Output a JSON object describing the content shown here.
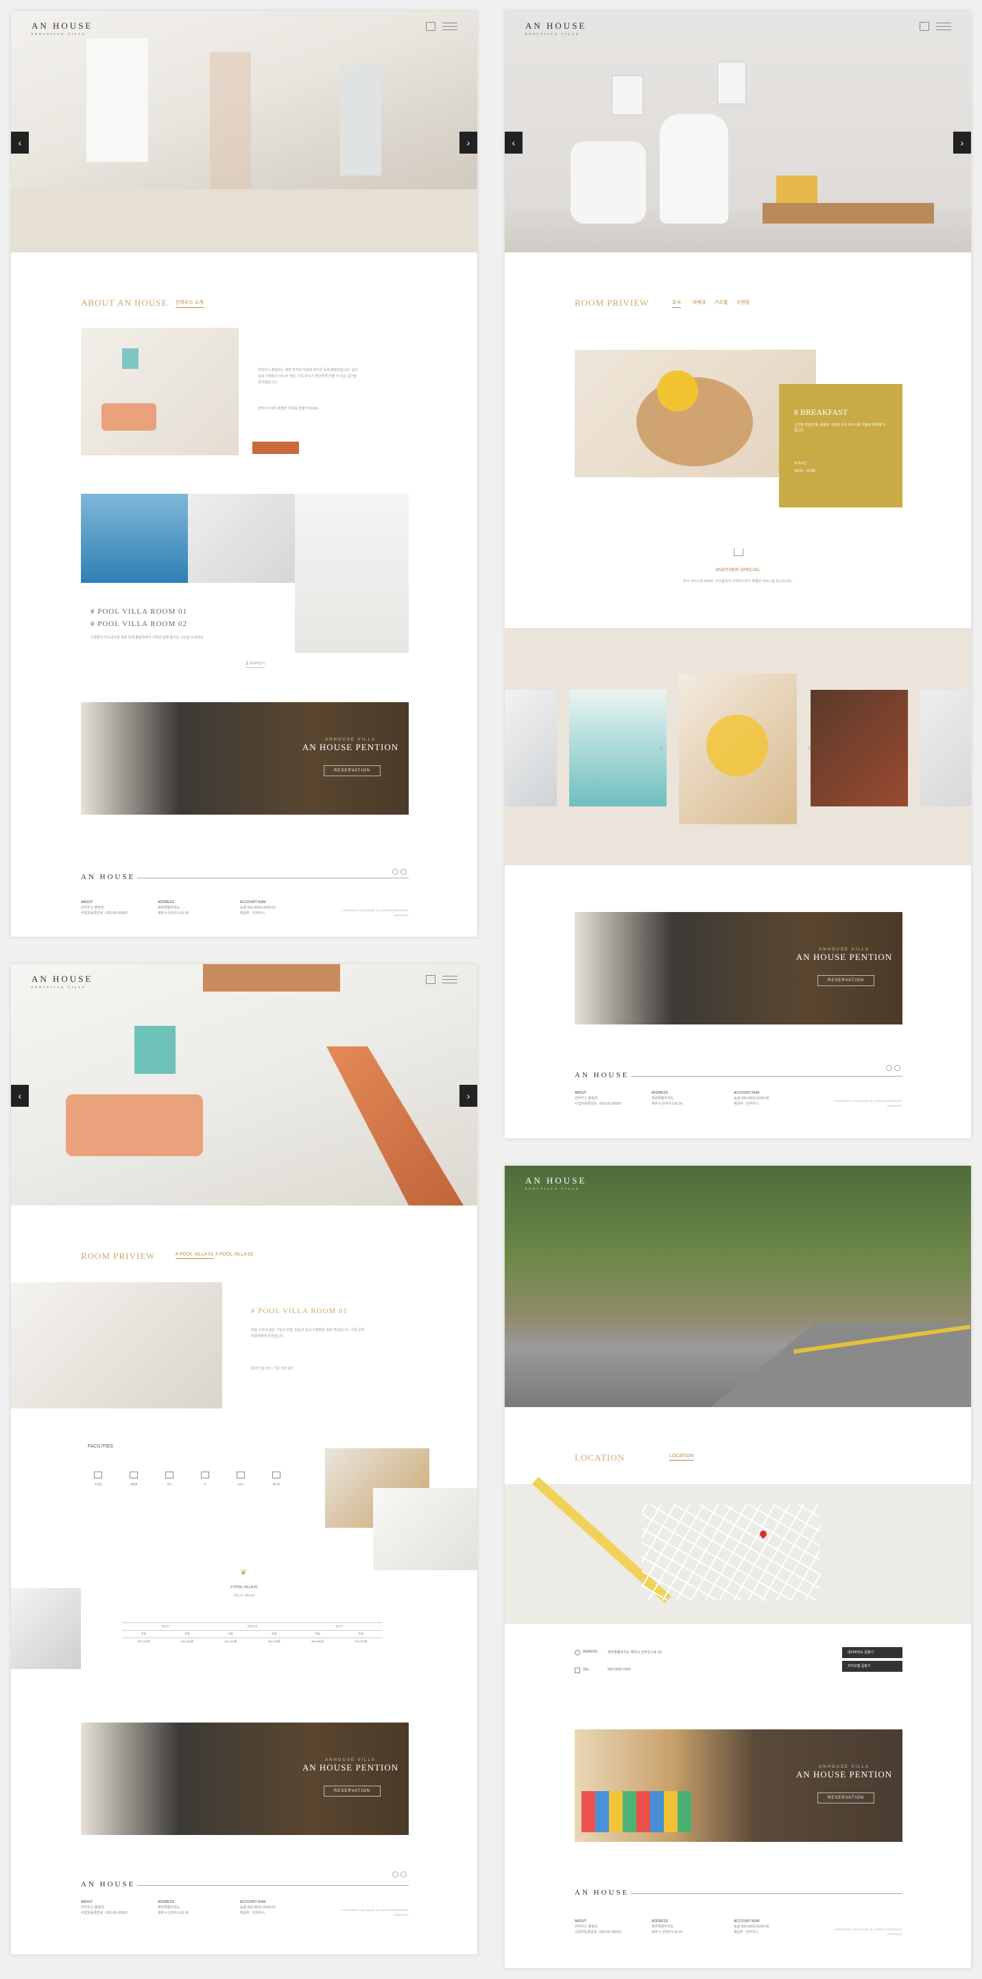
{
  "brand": {
    "name": "AN HOUSE",
    "sub": "POOLVILLA VILLA"
  },
  "panel1": {
    "about_title": "ABOUT AN HOUSE",
    "about_tab": "안하우스 소개",
    "about_para": "안하우스 풀빌라는 제주 한적한 마을에 자리한 독채 풀빌라입니다. 넓은 실내 수영장과 아늑한 객실, 가족 모두가 편안하게 머물 수 있는 공간을 준비했습니다.",
    "about_para2": "안하우스에서 특별한 하루를 만들어 보세요.",
    "room1": "# POOL VILLA ROOM 01",
    "room2": "# POOL VILLA ROOM 02",
    "rooms_para": "수영장과 키즈공간을 갖춘 독채 풀빌라에서 가족과 함께 즐거운 시간을 보내세요.",
    "rooms_more": "룸 자세히보기"
  },
  "banner": {
    "small": "ANHOUSE VILLA",
    "title": "AN HOUSE PENTION",
    "button": "RESERVATION"
  },
  "footer": {
    "col1_title": "ABOUT",
    "col1_l1": "안하우스 풀빌라",
    "col1_l2": "사업자등록번호 : 000-00-00000",
    "col2_title": "ADDRESS",
    "col2_l1": "제주특별자치도",
    "col2_l2": "제주시 안하우스로 00",
    "col3_title": "ACCOUNT NUM",
    "col3_l1": "농협 000-0000-0000-00",
    "col3_l2": "예금주 : 안하우스",
    "copy1": "COPYRIGHT © AN HOUSE. ALL RIGHTS RESERVED.",
    "copy2": "DESIGN BY"
  },
  "panel2": {
    "title": "ROOM PRIVIEW",
    "tabs": [
      "조식",
      "바베큐",
      "키즈룸",
      "수영장"
    ],
    "breakfast_title": "# BREAKFAST",
    "breakfast_text": "신선한 과일과 빵, 음료로 구성된 조식 바구니를 객실로 준비해 드립니다.",
    "breakfast_time": "조식시간",
    "breakfast_time_v": "08:00 ~ 10:00",
    "special_title": "ANOTHER SPECIAL",
    "special_text": "조식 서비스와 바베큐, 키즈룸까지 안하우스만의 특별한 서비스를 만나보세요."
  },
  "panel3": {
    "title": "ROOM PRIVIEW",
    "tab1": "# POOL VILLA 01",
    "tab2": "# POOL VILLA 02",
    "room_title": "# POOL VILLA ROOM 01",
    "room_text": "복층 구조의 넓은 거실과 주방, 침실과 실내 수영장을 갖춘 객실입니다. 가족 단위 여행객에게 추천합니다.",
    "room_text2": "최대 인원 8인 / 기준 인원 4인",
    "facilities": "FACILITIES",
    "fac": [
      "수영장",
      "바베큐",
      "욕조",
      "TV",
      "WIFI",
      "에어컨"
    ],
    "price_title": "# POOL VILLA 01",
    "price_sub": "기준 4인 / 최대 8인",
    "price_head": [
      "비수기",
      "준성수기",
      "성수기"
    ],
    "price_row1": [
      "주중",
      "주말",
      "주중",
      "주말",
      "주중",
      "주말"
    ],
    "price_row2": [
      "300,000원",
      "350,000원",
      "350,000원",
      "400,000원",
      "450,000원",
      "500,000원"
    ]
  },
  "panel4": {
    "title": "LOCATION",
    "tab": "LOCATION",
    "address_label": "ADRESS.",
    "address_value": "제주특별자치도 제주시 안하우스로 00",
    "tel_label": "TEL.",
    "tel_value": "000-0000-0000",
    "btn1": "네이버지도 길찾기",
    "btn2": "카카오맵 길찾기",
    "banner_small": "ANHOUSE VILLA",
    "banner_title": "AN HOUSE PENTION",
    "banner_button": "RESERVATION"
  }
}
